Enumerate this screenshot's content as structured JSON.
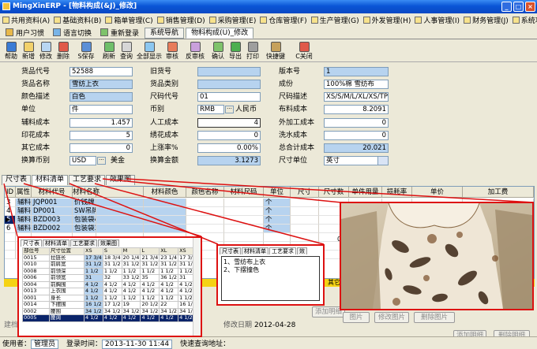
{
  "window": {
    "title": "MingXinERP - [物料构成(&J)_修改]"
  },
  "menu": [
    {
      "label": "共用资料(A)"
    },
    {
      "label": "基础资料(B)"
    },
    {
      "label": "箱单管理(C)"
    },
    {
      "label": "销售管理(D)"
    },
    {
      "label": "采购管理(E)"
    },
    {
      "label": "仓库管理(F)"
    },
    {
      "label": "生产管理(G)"
    },
    {
      "label": "外发管理(H)"
    },
    {
      "label": "人事管理(I)"
    },
    {
      "label": "财务管理(J)"
    },
    {
      "label": "系统功能(K)"
    },
    {
      "label": "图表功能"
    }
  ],
  "tabbar": {
    "habit": "用户习惯",
    "lang": "语言切换",
    "relogin": "重新登录",
    "tab_nav": "系统导航",
    "tab_doc": "物料构成(U)_修改"
  },
  "toolbar": [
    {
      "label": "帮助",
      "icon": "help-icon",
      "color": "#3a7bd5"
    },
    {
      "label": "新增",
      "icon": "new-icon",
      "color": "#f2d16b"
    },
    {
      "label": "修改",
      "icon": "edit-icon",
      "color": "#b8d6f2"
    },
    {
      "label": "删除",
      "icon": "delete-icon",
      "color": "#e05a4a"
    },
    {
      "label": "S保存",
      "icon": "save-icon",
      "color": "#5b8fd6"
    },
    {
      "label": "刷新",
      "icon": "refresh-icon",
      "color": "#6fbf6a"
    },
    {
      "label": "查询",
      "icon": "search-icon",
      "color": "#d6d6d6"
    },
    {
      "label": "全部显示",
      "icon": "show-all-icon",
      "color": "#8cc7f0"
    },
    {
      "label": "审核",
      "icon": "audit-icon",
      "color": "#e87c5a"
    },
    {
      "label": "反审核",
      "icon": "unaudit-icon",
      "color": "#c9a0dc"
    },
    {
      "label": "确认",
      "icon": "confirm-icon",
      "color": "#7fc36b"
    },
    {
      "label": "导出",
      "icon": "export-icon",
      "color": "#4caf50"
    },
    {
      "label": "打印",
      "icon": "print-icon",
      "color": "#9e9e9e"
    },
    {
      "label": "快捷键",
      "icon": "shortcut-icon",
      "color": "#c6a15b"
    },
    {
      "label": "C关闭",
      "icon": "close-icon",
      "color": "#e05a4a"
    }
  ],
  "form": {
    "goods_code_label": "货品代号",
    "goods_code": "52588",
    "old_code_label": "旧货号",
    "old_code": "",
    "version_label": "版本号",
    "version": "1",
    "goods_name_label": "货品名称",
    "goods_name": "雪纺上衣",
    "goods_cat_label": "货品类别",
    "goods_cat": "",
    "composition_label": "成份",
    "composition": "100%棉 雪纺布",
    "color_label": "颜色描述",
    "color": "白色",
    "size_code_label": "尺码代号",
    "size_code": "01",
    "size_desc_label": "尺码描述",
    "size_desc": "XS/S/M/L/XL/XS/TP/XP",
    "unit_label": "单位",
    "unit": "件",
    "currency_label": "币别",
    "currency": "RMB",
    "currency_name": "人民币",
    "fabric_cost_label": "布料成本",
    "fabric_cost": "8.2091",
    "aux_cost_label": "辅料成本",
    "aux_cost": "1.457",
    "labor_cost_label": "人工成本",
    "labor_cost": "4",
    "outsource_cost_label": "外加工成本",
    "outsource_cost": "0",
    "print_cost_label": "印花成本",
    "print_cost": "5",
    "embroidery_cost_label": "绣花成本",
    "embroidery_cost": "0",
    "wash_cost_label": "洗水成本",
    "wash_cost": "0",
    "other_cost_label": "其它成本",
    "other_cost": "0",
    "float_rate_label": "上涨率%",
    "float_rate": "0.00%",
    "total_cost_label": "总合计成本",
    "total_cost": "20.021",
    "conv_currency_label": "换算币别",
    "conv_currency": "USD",
    "conv_currency_name": "美金",
    "conv_amount_label": "换算金额",
    "conv_amount": "3.1273",
    "size_unit_label": "尺寸单位",
    "size_unit": "英寸"
  },
  "subtabs": [
    "尺寸表",
    "材料清单",
    "工艺要求",
    "效果图"
  ],
  "grid": {
    "headers": [
      "ID",
      "属性",
      "材料代号",
      "材料名称",
      "材料颜色",
      "颜色名称",
      "材料尺码",
      "单位",
      "尺寸",
      "尺寸数",
      "单件用量",
      "损耗率",
      "单价",
      "加工费"
    ],
    "rows": [
      {
        "id": "3",
        "attr": "辅料",
        "code": "JQP001",
        "name": "价钱牌",
        "unit": "个"
      },
      {
        "id": "4",
        "attr": "辅料",
        "code": "DP001",
        "name": "SW吊牌",
        "unit": "个"
      },
      {
        "id": "5",
        "attr": "辅料",
        "code": "BZD003",
        "name": "包装袋46*56",
        "unit": "个"
      },
      {
        "id": "6",
        "attr": "辅料",
        "code": "BZD002",
        "name": "包装袋32*42",
        "unit": "个"
      }
    ],
    "marker": "▶",
    "other_label": "其它",
    "row_partial": "0.1"
  },
  "footer": {
    "creator_label": "建档",
    "modify_date_label": "修改日期",
    "modify_date": "2012-04-28",
    "add_detail": "添加明细",
    "delete_detail": "删除明细",
    "add_detail2": "添加明细"
  },
  "image_buttons": [
    "图片",
    "修改图片",
    "删除图片"
  ],
  "status": {
    "user_label": "使用者：",
    "user": "管理员",
    "login_label": "登录时间：",
    "login": "2013-11-30 11:44",
    "query_label": "快速查询地址："
  },
  "callout_size": {
    "tabs": [
      "尺寸表",
      "材料清单",
      "工艺要求",
      "效果图"
    ],
    "headers": [
      "部位号",
      "尺寸位置",
      "XS",
      "S",
      "M",
      "L",
      "XL",
      "XS"
    ],
    "rows": [
      [
        "0015",
        "拉链长",
        "17 3/4",
        "18 3/4",
        "20 1/4",
        "21 3/4",
        "23 1/4",
        "17 3/4"
      ],
      [
        "0010",
        "前肩宽",
        "31 1/2",
        "31 1/2",
        "31 1/2",
        "31 1/2",
        "31 1/2",
        "31 1/2"
      ],
      [
        "0008",
        "前领深",
        "1 1/2",
        "1 1/2",
        "1 1/2",
        "1 1/2",
        "1 1/2",
        "1 1/2"
      ],
      [
        "0006",
        "前领宽",
        "31",
        "32",
        "33 1/2",
        "35",
        "36 1/2",
        "31"
      ],
      [
        "0004",
        "前胸围",
        "4 1/2",
        "4 1/2",
        "4 1/2",
        "4 1/2",
        "4 1/2",
        "4 1/2"
      ],
      [
        "0013",
        "上衣围",
        "4 1/2",
        "4 1/2",
        "4 1/2",
        "4 1/2",
        "4 1/2",
        "4 1/2"
      ],
      [
        "0001",
        "身长",
        "1 1/2",
        "1 1/2",
        "1 1/2",
        "1 1/2",
        "1 1/2",
        "1 1/2"
      ],
      [
        "0014",
        "下摆围",
        "16 1/2",
        "17 1/2",
        "19",
        "20 1/2",
        "22",
        "16 1/2"
      ],
      [
        "0002",
        "腰围",
        "34 1/2",
        "34 1/2",
        "34 1/2",
        "34 1/2",
        "34 1/2",
        "34 1/2"
      ],
      [
        "0005",
        "腰阔",
        "4 1/2",
        "4 1/2",
        "4 1/2",
        "4 1/2",
        "4 1/2",
        "4 1/2"
      ]
    ]
  },
  "callout_craft": {
    "tabs": [
      "尺寸表",
      "材料清单",
      "工艺要求",
      "效"
    ],
    "lines": [
      "1、雪纺布上衣",
      "2、下摆撞色"
    ]
  },
  "colors": {
    "callout": "#dd1111",
    "selection": "#0a246a",
    "blue_cell": "#b7d3ef",
    "titlebar": "#0a55d6"
  }
}
